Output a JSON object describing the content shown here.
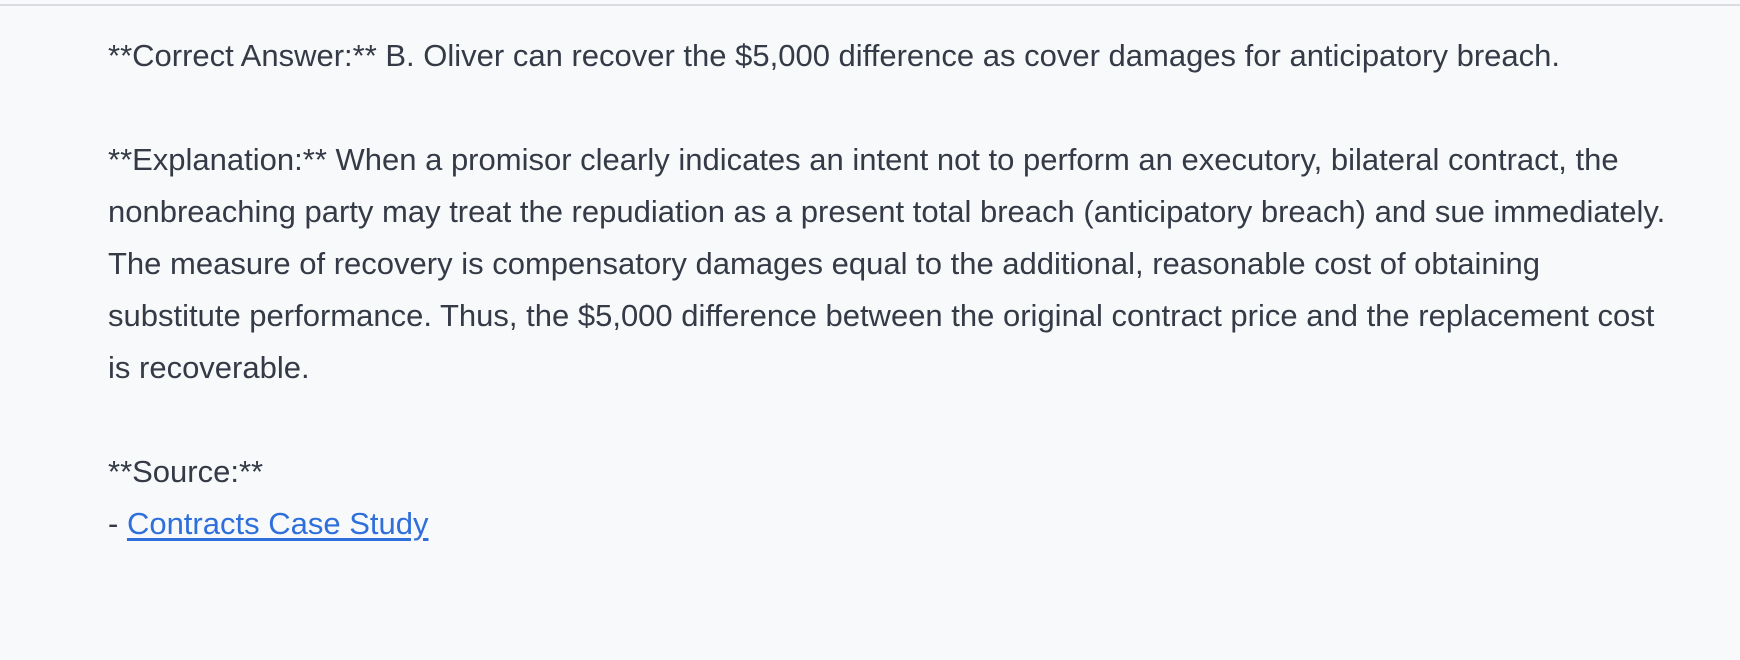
{
  "answer": {
    "text": "**Correct Answer:** B. Oliver can recover the $5,000 difference as cover damages for anticipatory breach."
  },
  "explanation": {
    "text": "**Explanation:** When a promisor clearly indicates an intent not to perform an executory, bilateral contract, the nonbreaching party may treat the repudiation as a present total breach (anticipatory breach) and sue immediately. The measure of recovery is compensatory damages equal to the additional, reasonable cost of obtaining substitute performance. Thus, the $5,000 difference between the original contract price and the replacement cost is recoverable."
  },
  "source": {
    "heading": "**Source:**",
    "bullet": "- ",
    "link_text": "Contracts Case Study"
  },
  "colors": {
    "background": "#f8f9fb",
    "text": "#343a46",
    "link": "#2f6fdb",
    "divider": "#d9dce1"
  }
}
